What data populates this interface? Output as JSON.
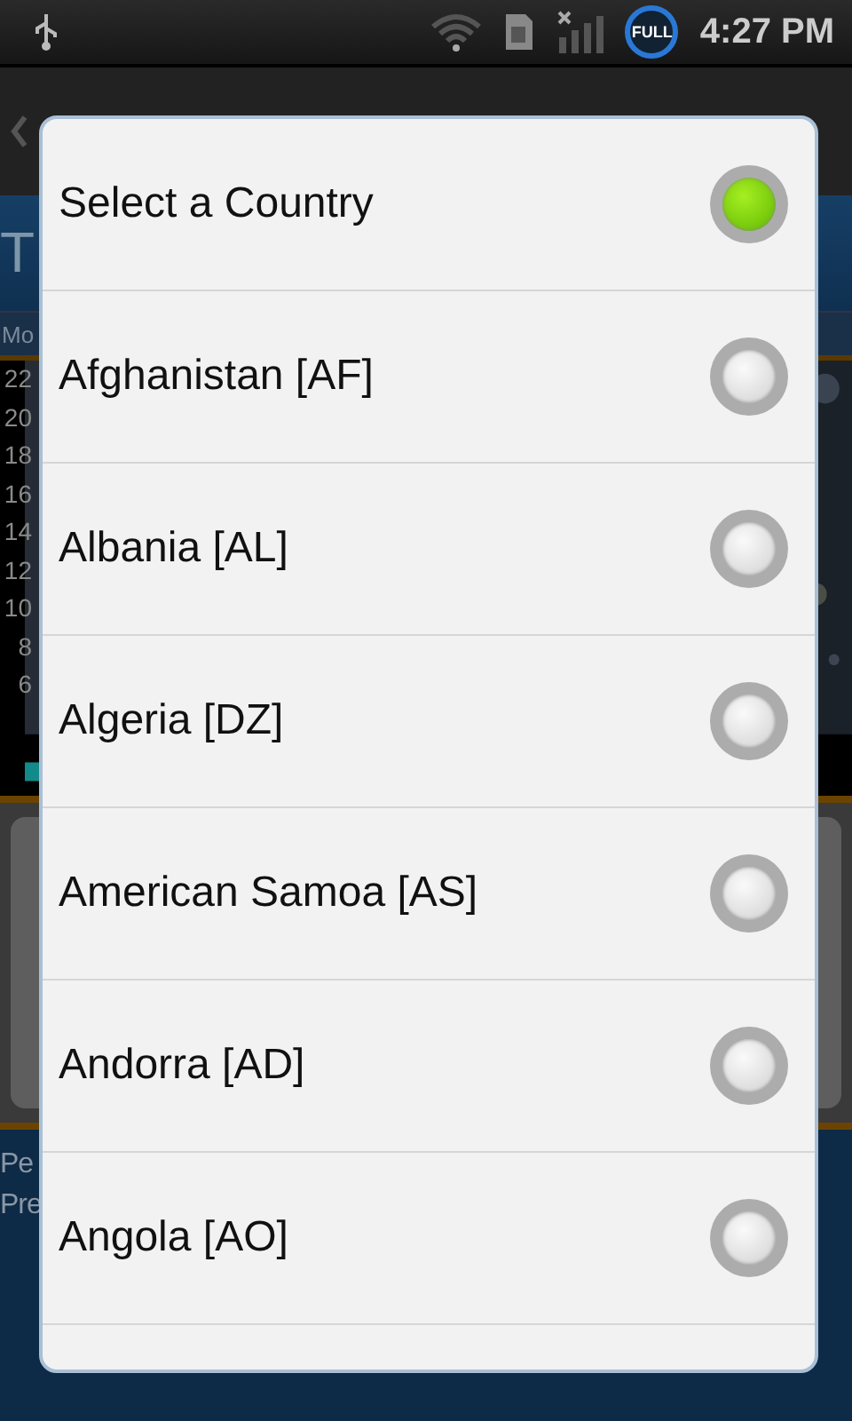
{
  "status_bar": {
    "badge": "FULL",
    "time": "4:27 PM"
  },
  "background": {
    "title": "T",
    "tab": "Mo",
    "axis_labels": [
      "22",
      "20",
      "18",
      "16",
      "14",
      "12",
      "10",
      "8",
      "6"
    ],
    "footer_lines": [
      "Pe",
      "Pre"
    ]
  },
  "dialog": {
    "items": [
      {
        "label": "Select a Country",
        "selected": true
      },
      {
        "label": "Afghanistan [AF]",
        "selected": false
      },
      {
        "label": "Albania [AL]",
        "selected": false
      },
      {
        "label": "Algeria [DZ]",
        "selected": false
      },
      {
        "label": "American Samoa [AS]",
        "selected": false
      },
      {
        "label": "Andorra [AD]",
        "selected": false
      },
      {
        "label": "Angola [AO]",
        "selected": false
      }
    ]
  }
}
